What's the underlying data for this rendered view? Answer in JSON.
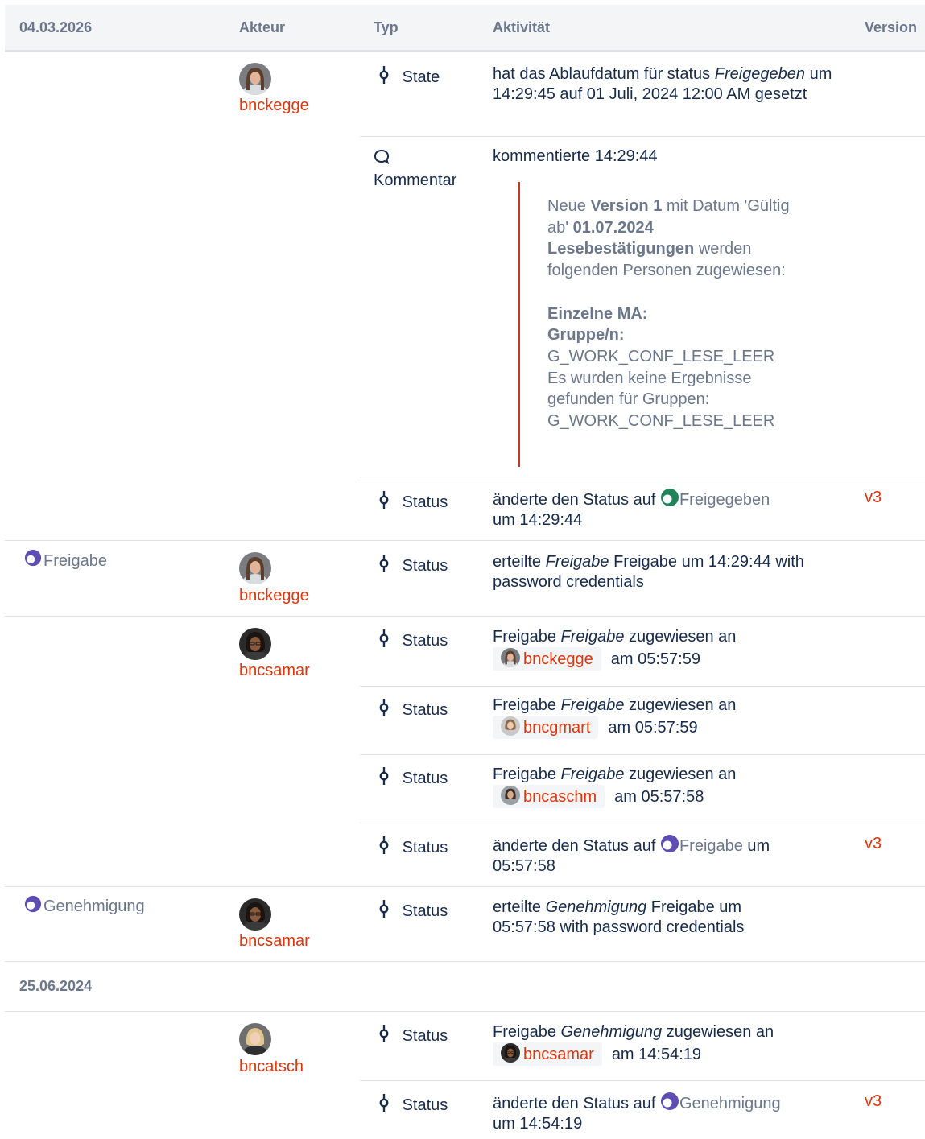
{
  "columns": [
    "04.03.2026",
    "Akteur",
    "Typ",
    "Aktivität",
    "Version"
  ],
  "sections": [
    {
      "date": "04.03.2026"
    },
    {
      "date": "25.06.2024"
    }
  ],
  "users": {
    "bnckegge": "bnckegge",
    "bncsamar": "bncsamar",
    "bncatsch": "bncatsch"
  },
  "stages": {
    "freigabe": "Freigabe",
    "genehmigung": "Genehmigung"
  },
  "types": {
    "state": "State",
    "kommentar": "Kommentar",
    "status": "Status"
  },
  "rows": {
    "r1": {
      "prefix": "hat das Ablaufdatum für status ",
      "emph": "Freigegeben",
      "suffix": " um 14:29:45 auf 01 Juli, 2024 12:00 AM gesetzt"
    },
    "r2": {
      "text": "kommentierte 14:29:44"
    },
    "comment": {
      "t1": "Neue ",
      "b1": "Version 1",
      "t2": " mit Datum 'Gültig ab' ",
      "b2": "01.07.2024",
      "b3": "Lesebestätigungen",
      "t3": " werden folgenden Personen zugewiesen:",
      "b4": "Einzelne MA:",
      "b5": "Gruppe/n:",
      "t4": "G_WORK_CONF_LESE_LEER",
      "t5": "Es wurden keine Ergebnisse gefunden für Gruppen: G_WORK_CONF_LESE_LEER"
    },
    "r3": {
      "prefix": "änderte den Status auf ",
      "state": "Freigegeben",
      "suffix": "um 14:29:44",
      "version": "v3"
    },
    "r4": {
      "prefix": "erteilte ",
      "emph": "Freigabe",
      "suffix": " Freigabe um 14:29:44 with password credentials"
    },
    "r5": {
      "prefix": "Freigabe ",
      "emph": "Freigabe",
      "suffix": " zugewiesen an",
      "user": "bnckegge",
      "time": "am 05:57:59"
    },
    "r6": {
      "prefix": "Freigabe ",
      "emph": "Freigabe",
      "suffix": " zugewiesen an",
      "user": "bncgmart",
      "time": "am 05:57:59"
    },
    "r7": {
      "prefix": "Freigabe ",
      "emph": "Freigabe",
      "suffix": " zugewiesen an",
      "user": "bncaschm",
      "time": "am 05:57:58"
    },
    "r8": {
      "prefix": "änderte den Status auf ",
      "state": "Freigabe",
      "suffix1": " um",
      "suffix2": "05:57:58",
      "version": "v3"
    },
    "r9": {
      "prefix": "erteilte ",
      "emph": "Genehmigung",
      "suffix": " Freigabe um 05:57:58 with password credentials"
    },
    "r10": {
      "prefix": "Freigabe ",
      "emph": "Genehmigung",
      "suffix": " zugewiesen an",
      "user": "bncsamar",
      "time": "am 14:54:19"
    },
    "r11": {
      "prefix": "änderte den Status auf ",
      "state": "Genehmigung",
      "suffix": "um 14:54:19",
      "version": "v3"
    }
  },
  "colors": {
    "link_red": "#de350b",
    "status_green": "#1f845a",
    "status_purple": "#5e4db2",
    "quote_bar": "#c9372c"
  }
}
